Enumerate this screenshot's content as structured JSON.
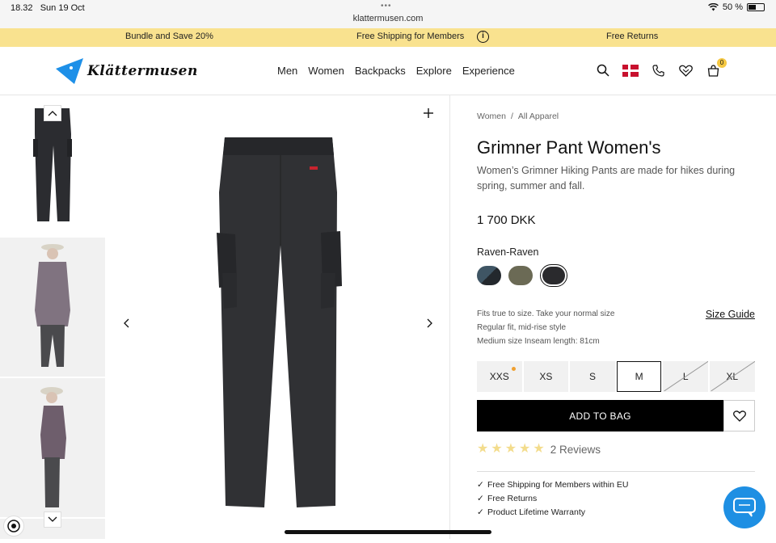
{
  "statusbar": {
    "time": "18.32",
    "date": "Sun 19 Oct",
    "url": "klattermusen.com",
    "battery": "50 %"
  },
  "promo": {
    "left": "Bundle and Save 20%",
    "center": "Free Shipping for Members",
    "right": "Free Returns"
  },
  "header": {
    "brand": "Klättermusen",
    "nav": [
      "Men",
      "Women",
      "Backpacks",
      "Explore",
      "Experience"
    ],
    "bag_count": "0"
  },
  "breadcrumb": [
    "Women",
    "All Apparel"
  ],
  "product": {
    "title": "Grimner Pant Women's",
    "description": "Women’s Grimner Hiking Pants are made for hikes during spring, summer and fall.",
    "price": "1 700 DKK",
    "color_name": "Raven-Raven",
    "fit_notes": [
      "Fits true to size. Take your normal size",
      "Regular fit, mid-rise style",
      "Medium size Inseam length: 81cm"
    ],
    "size_guide": "Size Guide",
    "sizes": [
      {
        "label": "XXS",
        "low_stock": true
      },
      {
        "label": "XS"
      },
      {
        "label": "S"
      },
      {
        "label": "M",
        "selected": true
      },
      {
        "label": "L",
        "out_of_stock": true
      },
      {
        "label": "XL",
        "out_of_stock": true
      }
    ],
    "add_to_bag": "ADD TO BAG",
    "rating": 5,
    "reviews": "2 Reviews",
    "perks": [
      "Free Shipping for Members within EU",
      "Free Returns",
      "Product Lifetime Warranty"
    ]
  },
  "colors": {
    "promo": "#f9e28f",
    "logo": "#1e90e8",
    "chat": "#1e8fe3",
    "star": "#f3dc8c",
    "swatch_blue": "#3f5564",
    "swatch_olive": "#6b6a55",
    "swatch_raven": "#2a2a2d"
  }
}
